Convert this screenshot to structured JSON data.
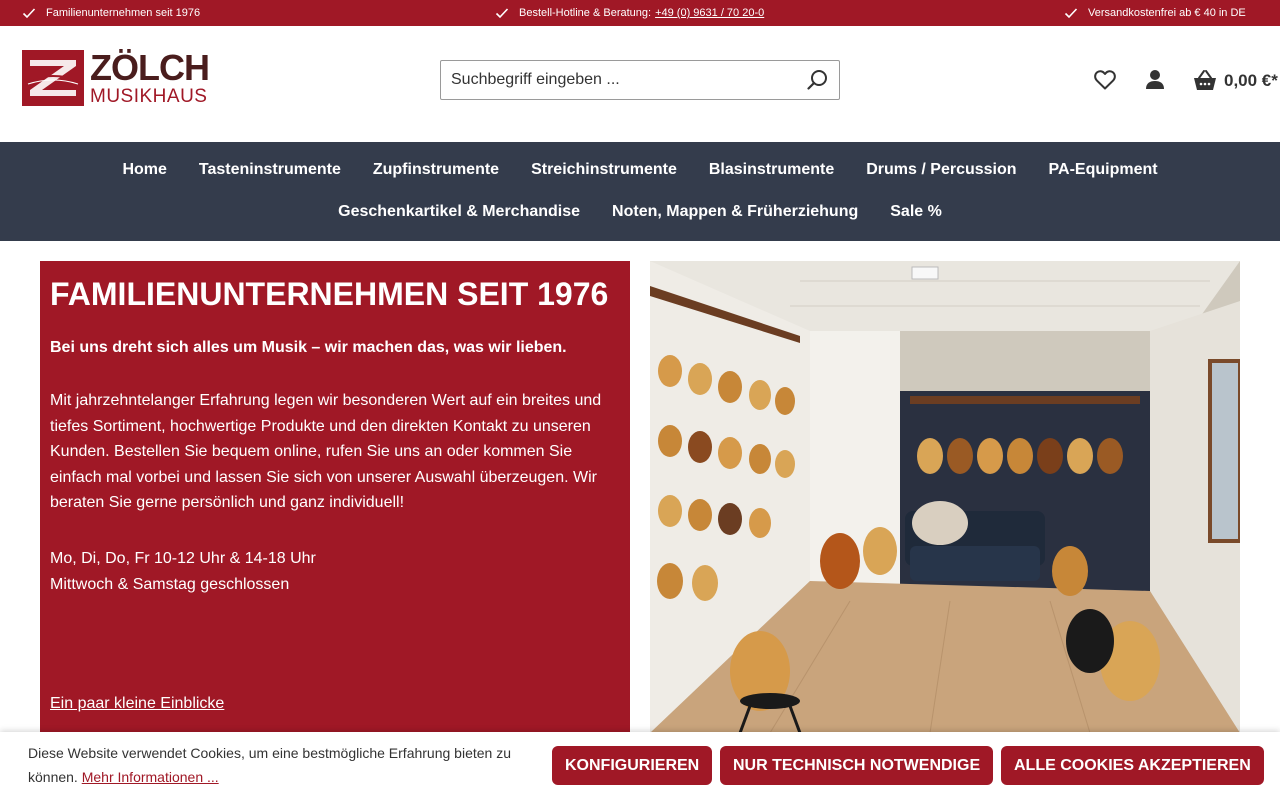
{
  "topbar": {
    "item1": "Familienunternehmen seit 1976",
    "item2_label": "Bestell-Hotline & Beratung:",
    "item2_phone": "+49 (0) 9631 / 70 20-0",
    "item3": "Versandkostenfrei ab € 40 in DE"
  },
  "logo": {
    "line1": "ZÖLCH",
    "line2": "MUSIKHAUS"
  },
  "search": {
    "placeholder": "Suchbegriff eingeben ..."
  },
  "cart": {
    "total": "0,00 €*"
  },
  "nav": {
    "row1": [
      "Home",
      "Tasteninstrumente",
      "Zupfinstrumente",
      "Streichinstrumente",
      "Blasinstrumente",
      "Drums / Percussion",
      "PA-Equipment"
    ],
    "row2": [
      "Geschenkartikel & Merchandise",
      "Noten, Mappen & Früherziehung",
      "Sale %"
    ]
  },
  "hero": {
    "title": "FAMILIENUNTERNEHMEN SEIT 1976",
    "lead": "Bei uns dreht sich alles um Musik – wir machen das, was wir lieben.",
    "body": "Mit jahrzehntelanger Erfahrung legen wir besonderen Wert auf ein breites und tiefes Sortiment, hochwertige Produkte und den direkten Kontakt zu unseren Kunden. Bestellen Sie bequem online, rufen Sie uns an oder kommen Sie einfach mal vorbei und lassen Sie sich von unserer Auswahl überzeugen. Wir beraten Sie gerne persönlich und ganz individuell!",
    "hours1": "Mo, Di, Do, Fr 10-12 Uhr & 14-18 Uhr",
    "hours2": "Mittwoch & Samstag geschlossen",
    "link": "Ein paar kleine Einblicke"
  },
  "cookie": {
    "message": "Diese Website verwendet Cookies, um eine bestmögliche Erfahrung bieten zu können.",
    "more": "Mehr Informationen ...",
    "btn_configure": "KONFIGURIEREN",
    "btn_necessary": "NUR TECHNISCH NOTWENDIGE",
    "btn_accept": "ALLE COOKIES AKZEPTIEREN"
  },
  "colors": {
    "brand_red": "#a01826",
    "nav_bg": "#343c4c",
    "logo_dark": "#4a1d1d"
  },
  "icons": [
    "check-icon",
    "search-icon",
    "heart-icon",
    "user-icon",
    "basket-icon"
  ]
}
